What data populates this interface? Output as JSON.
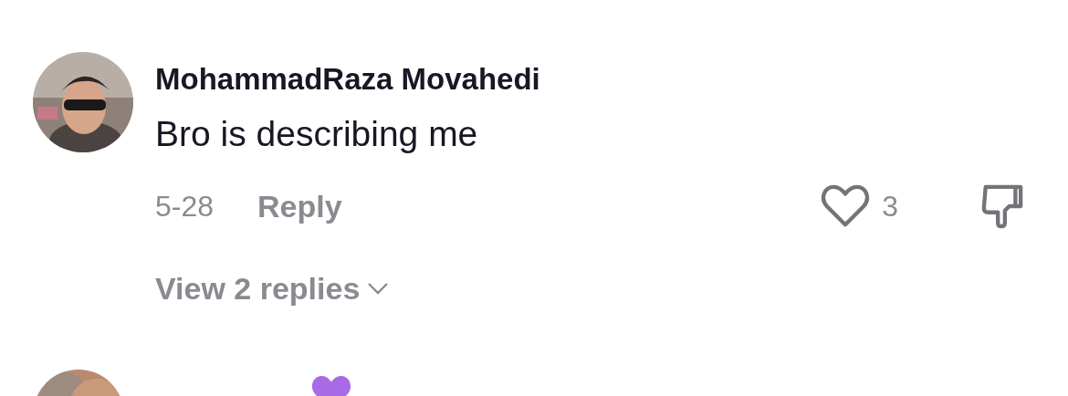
{
  "comments": [
    {
      "username": "MohammadRaza Movahedi",
      "text": "Bro is describing me",
      "date": "5-28",
      "reply_label": "Reply",
      "likes": "3",
      "liked": false,
      "view_replies": "View 2 replies"
    }
  ]
}
